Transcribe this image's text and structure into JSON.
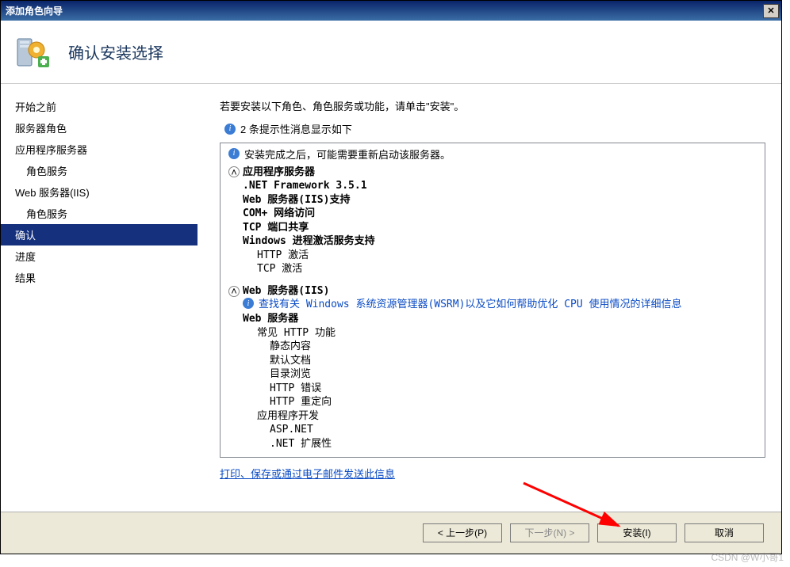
{
  "window": {
    "title": "添加角色向导"
  },
  "header": {
    "title": "确认安装选择"
  },
  "sidebar": {
    "items": [
      {
        "label": "开始之前",
        "indent": false
      },
      {
        "label": "服务器角色",
        "indent": false
      },
      {
        "label": "应用程序服务器",
        "indent": false
      },
      {
        "label": "角色服务",
        "indent": true
      },
      {
        "label": "Web 服务器(IIS)",
        "indent": false
      },
      {
        "label": "角色服务",
        "indent": true
      },
      {
        "label": "确认",
        "indent": false,
        "selected": true
      },
      {
        "label": "进度",
        "indent": false
      },
      {
        "label": "结果",
        "indent": false
      }
    ]
  },
  "content": {
    "instruction": "若要安装以下角色、角色服务或功能，请单击\"安装\"。",
    "info_summary": "2 条提示性消息显示如下",
    "restart_note": "安装完成之后，可能需要重新启动该服务器。",
    "section1": {
      "title": "应用程序服务器",
      "items": [
        ".NET Framework 3.5.1",
        "Web 服务器(IIS)支持",
        "COM+ 网络访问",
        "TCP 端口共享",
        "Windows 进程激活服务支持"
      ],
      "sub": [
        "HTTP 激活",
        "TCP 激活"
      ]
    },
    "section2": {
      "title": "Web 服务器(IIS)",
      "info_link": "查找有关 Windows 系统资源管理器(WSRM)以及它如何帮助优化 CPU 使用情况的详细信息",
      "web_server": "Web 服务器",
      "group1": {
        "title": "常见 HTTP 功能",
        "items": [
          "静态内容",
          "默认文档",
          "目录浏览",
          "HTTP 错误",
          "HTTP 重定向"
        ]
      },
      "group2": {
        "title": "应用程序开发",
        "items": [
          "ASP.NET",
          ".NET 扩展性"
        ]
      }
    },
    "print_link": "打印、保存或通过电子邮件发送此信息"
  },
  "footer": {
    "prev": "< 上一步(P)",
    "next": "下一步(N) >",
    "install": "安装(I)",
    "cancel": "取消"
  },
  "watermark": "CSDN @W小哥1"
}
